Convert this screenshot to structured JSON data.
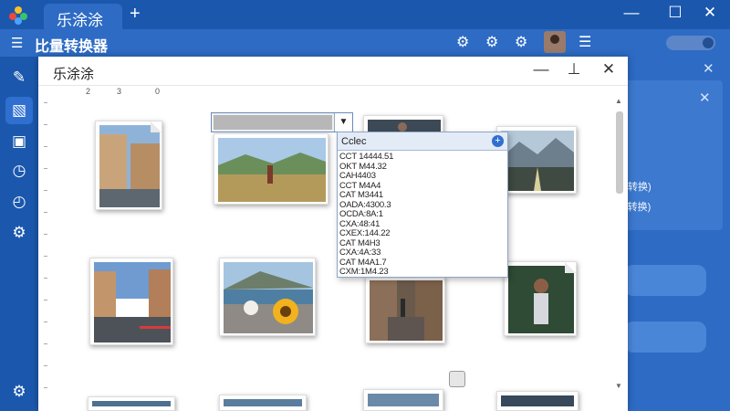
{
  "tabbar": {
    "tab_label": "乐涂涂",
    "add_label": "+",
    "minimize": "—",
    "maximize": "☐",
    "close": "✕"
  },
  "toolbar": {
    "menu_glyph": "☰",
    "app_title": "比量转换器",
    "icons": [
      "gear-icon",
      "clock-gear-icon",
      "settings-icon",
      "list-icon"
    ]
  },
  "sidebar": {
    "items": [
      "edit-pencil-icon",
      "image-edit-icon",
      "robot-icon",
      "clock-icon",
      "history-icon",
      "settings-icon",
      "bottom-settings-icon"
    ]
  },
  "background_panel": {
    "partial_text": [
      "转换)",
      "(转换)"
    ]
  },
  "dialog": {
    "title": "乐涂涂",
    "ruler_labels": [
      "2",
      "3",
      "0"
    ],
    "minimize": "—",
    "pin": "⊥",
    "close": "✕"
  },
  "dropdown": {
    "header": "Cclec",
    "plus": "+",
    "items": [
      "CCT 14444.51",
      "OKT M44.32",
      "CAH4403",
      "CCT M4A4",
      "CAT M3441",
      "OADA:4300.3",
      "OCDA:8A:1",
      "CXA:48:41",
      "CXEX:144.22",
      "CAT M4H3",
      "CXA:4A:33",
      "CAT M4A1.7",
      "CXM:1M4.23"
    ]
  },
  "colors": {
    "brand_blue": "#1b58ad",
    "toolbar_blue": "#2d6bc4",
    "accent": "#2f6fd0"
  }
}
